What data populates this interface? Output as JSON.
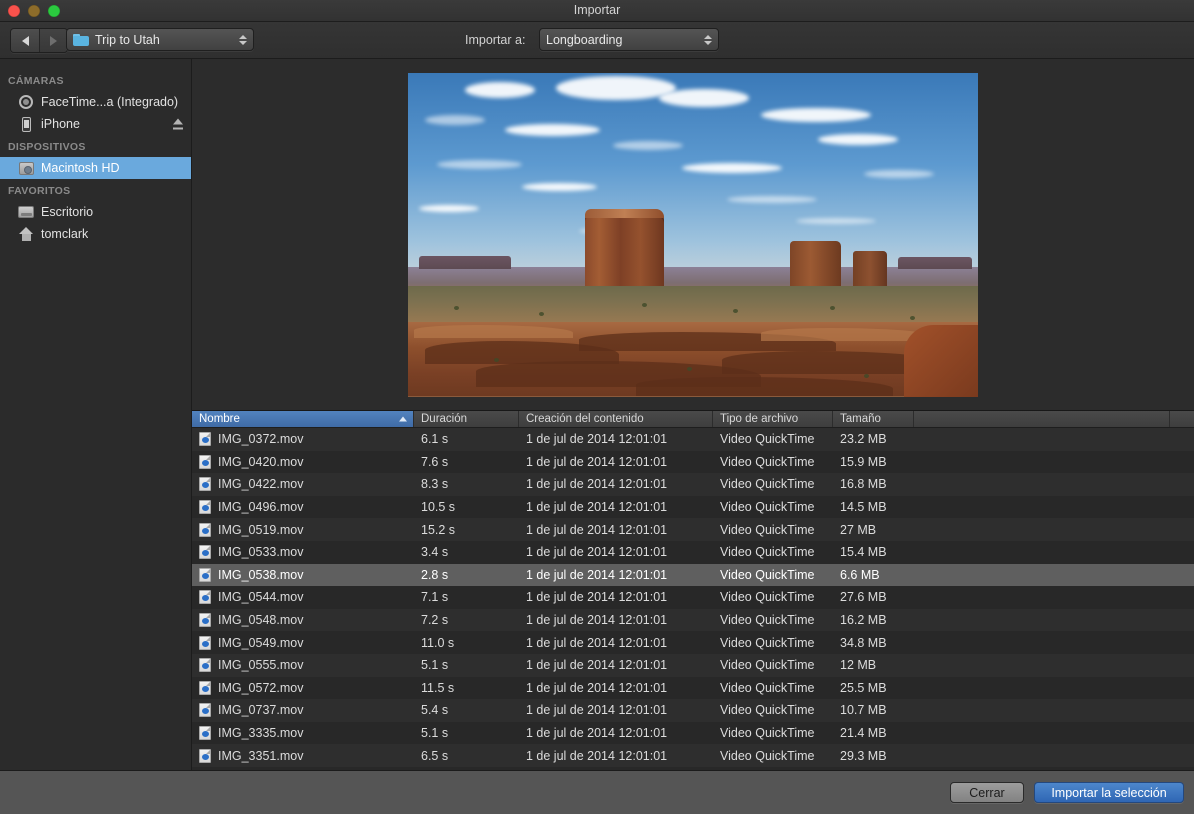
{
  "window": {
    "title": "Importar",
    "traffic_lights": [
      "close-light",
      "minimize-light",
      "maximize-light"
    ]
  },
  "toolbar": {
    "back_icon": "back-arrow-icon",
    "forward_icon": "forward-arrow-icon",
    "path_popup": {
      "icon": "folder-icon",
      "value": "Trip to Utah"
    },
    "import_to_label": "Importar a:",
    "destination_popup": {
      "value": "Longboarding"
    }
  },
  "sidebar": {
    "sections": [
      {
        "header": "CÁMARAS",
        "items": [
          {
            "label": "FaceTime...a (Integrado)",
            "icon": "camera-icon",
            "selected": false,
            "eject": false
          },
          {
            "label": "iPhone",
            "icon": "phone-icon",
            "selected": false,
            "eject": true
          }
        ]
      },
      {
        "header": "DISPOSITIVOS",
        "items": [
          {
            "label": "Macintosh HD",
            "icon": "hard-drive-icon",
            "selected": true,
            "eject": false
          }
        ]
      },
      {
        "header": "FAVORITOS",
        "items": [
          {
            "label": "Escritorio",
            "icon": "desktop-icon",
            "selected": false,
            "eject": false
          },
          {
            "label": "tomclark",
            "icon": "home-icon",
            "selected": false,
            "eject": false
          }
        ]
      }
    ]
  },
  "preview": {
    "description": "Monument Valley desert landscape with blue sky, clouds and red rock mesa"
  },
  "table": {
    "columns": [
      {
        "key": "name",
        "label": "Nombre",
        "sorted": true,
        "sort_direction": "ascending"
      },
      {
        "key": "duration",
        "label": "Duración",
        "sorted": false
      },
      {
        "key": "created",
        "label": "Creación del contenido",
        "sorted": false
      },
      {
        "key": "filetype",
        "label": "Tipo de archivo",
        "sorted": false
      },
      {
        "key": "size",
        "label": "Tamaño",
        "sorted": false
      }
    ],
    "rows": [
      {
        "name": "IMG_0372.mov",
        "duration": "6.1 s",
        "created": "1 de jul de 2014 12:01:01",
        "filetype": "Video QuickTime",
        "size": "23.2 MB",
        "selected": false
      },
      {
        "name": "IMG_0420.mov",
        "duration": "7.6 s",
        "created": "1 de jul de 2014 12:01:01",
        "filetype": "Video QuickTime",
        "size": "15.9 MB",
        "selected": false
      },
      {
        "name": "IMG_0422.mov",
        "duration": "8.3 s",
        "created": "1 de jul de 2014 12:01:01",
        "filetype": "Video QuickTime",
        "size": "16.8 MB",
        "selected": false
      },
      {
        "name": "IMG_0496.mov",
        "duration": "10.5 s",
        "created": "1 de jul de 2014 12:01:01",
        "filetype": "Video QuickTime",
        "size": "14.5 MB",
        "selected": false
      },
      {
        "name": "IMG_0519.mov",
        "duration": "15.2 s",
        "created": "1 de jul de 2014 12:01:01",
        "filetype": "Video QuickTime",
        "size": "27 MB",
        "selected": false
      },
      {
        "name": "IMG_0533.mov",
        "duration": "3.4 s",
        "created": "1 de jul de 2014 12:01:01",
        "filetype": "Video QuickTime",
        "size": "15.4 MB",
        "selected": false
      },
      {
        "name": "IMG_0538.mov",
        "duration": "2.8 s",
        "created": "1 de jul de 2014 12:01:01",
        "filetype": "Video QuickTime",
        "size": "6.6 MB",
        "selected": true
      },
      {
        "name": "IMG_0544.mov",
        "duration": "7.1 s",
        "created": "1 de jul de 2014 12:01:01",
        "filetype": "Video QuickTime",
        "size": "27.6 MB",
        "selected": false
      },
      {
        "name": "IMG_0548.mov",
        "duration": "7.2 s",
        "created": "1 de jul de 2014 12:01:01",
        "filetype": "Video QuickTime",
        "size": "16.2 MB",
        "selected": false
      },
      {
        "name": "IMG_0549.mov",
        "duration": "11.0 s",
        "created": "1 de jul de 2014 12:01:01",
        "filetype": "Video QuickTime",
        "size": "34.8 MB",
        "selected": false
      },
      {
        "name": "IMG_0555.mov",
        "duration": "5.1 s",
        "created": "1 de jul de 2014 12:01:01",
        "filetype": "Video QuickTime",
        "size": "12 MB",
        "selected": false
      },
      {
        "name": "IMG_0572.mov",
        "duration": "11.5 s",
        "created": "1 de jul de 2014 12:01:01",
        "filetype": "Video QuickTime",
        "size": "25.5 MB",
        "selected": false
      },
      {
        "name": "IMG_0737.mov",
        "duration": "5.4 s",
        "created": "1 de jul de 2014 12:01:01",
        "filetype": "Video QuickTime",
        "size": "10.7 MB",
        "selected": false
      },
      {
        "name": "IMG_3335.mov",
        "duration": "5.1 s",
        "created": "1 de jul de 2014 12:01:01",
        "filetype": "Video QuickTime",
        "size": "21.4 MB",
        "selected": false
      },
      {
        "name": "IMG_3351.mov",
        "duration": "6.5 s",
        "created": "1 de jul de 2014 12:01:01",
        "filetype": "Video QuickTime",
        "size": "29.3 MB",
        "selected": false
      }
    ]
  },
  "footer": {
    "close_label": "Cerrar",
    "import_label": "Importar la selección"
  },
  "colors": {
    "sidebar_selection": "#6aa9dd",
    "sorted_header": "#4a78b4",
    "primary_button": "#3f73bf",
    "row_selection": "#5f5f5f",
    "window_background": "#2c2c2c",
    "bottom_bar": "#555555"
  }
}
